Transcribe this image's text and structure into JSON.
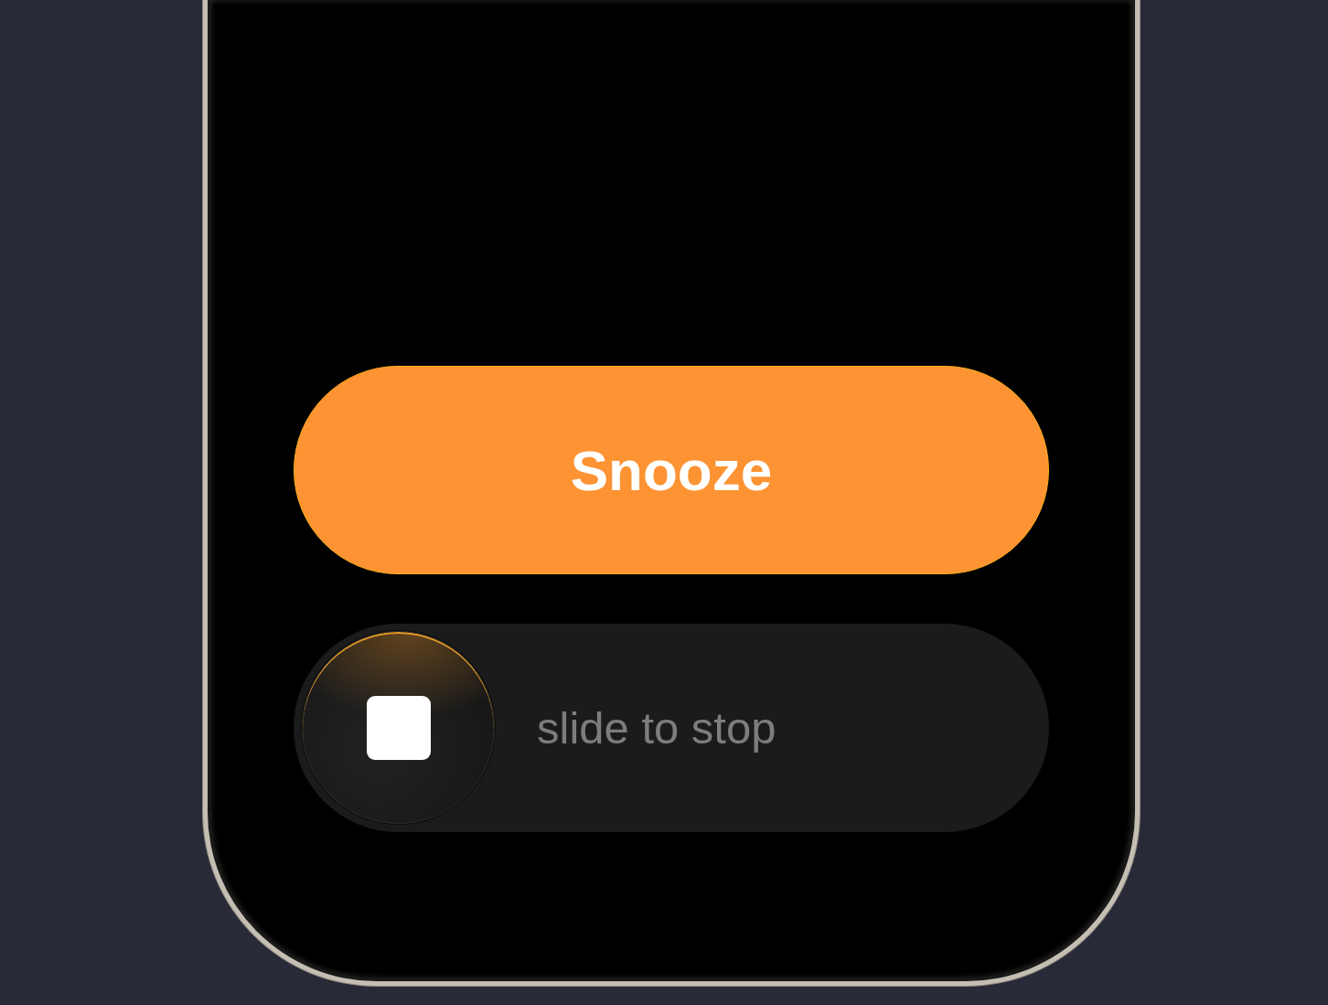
{
  "snooze_button": {
    "label": "Snooze"
  },
  "stop_slider": {
    "label": "slide to stop",
    "level": 0
  }
}
